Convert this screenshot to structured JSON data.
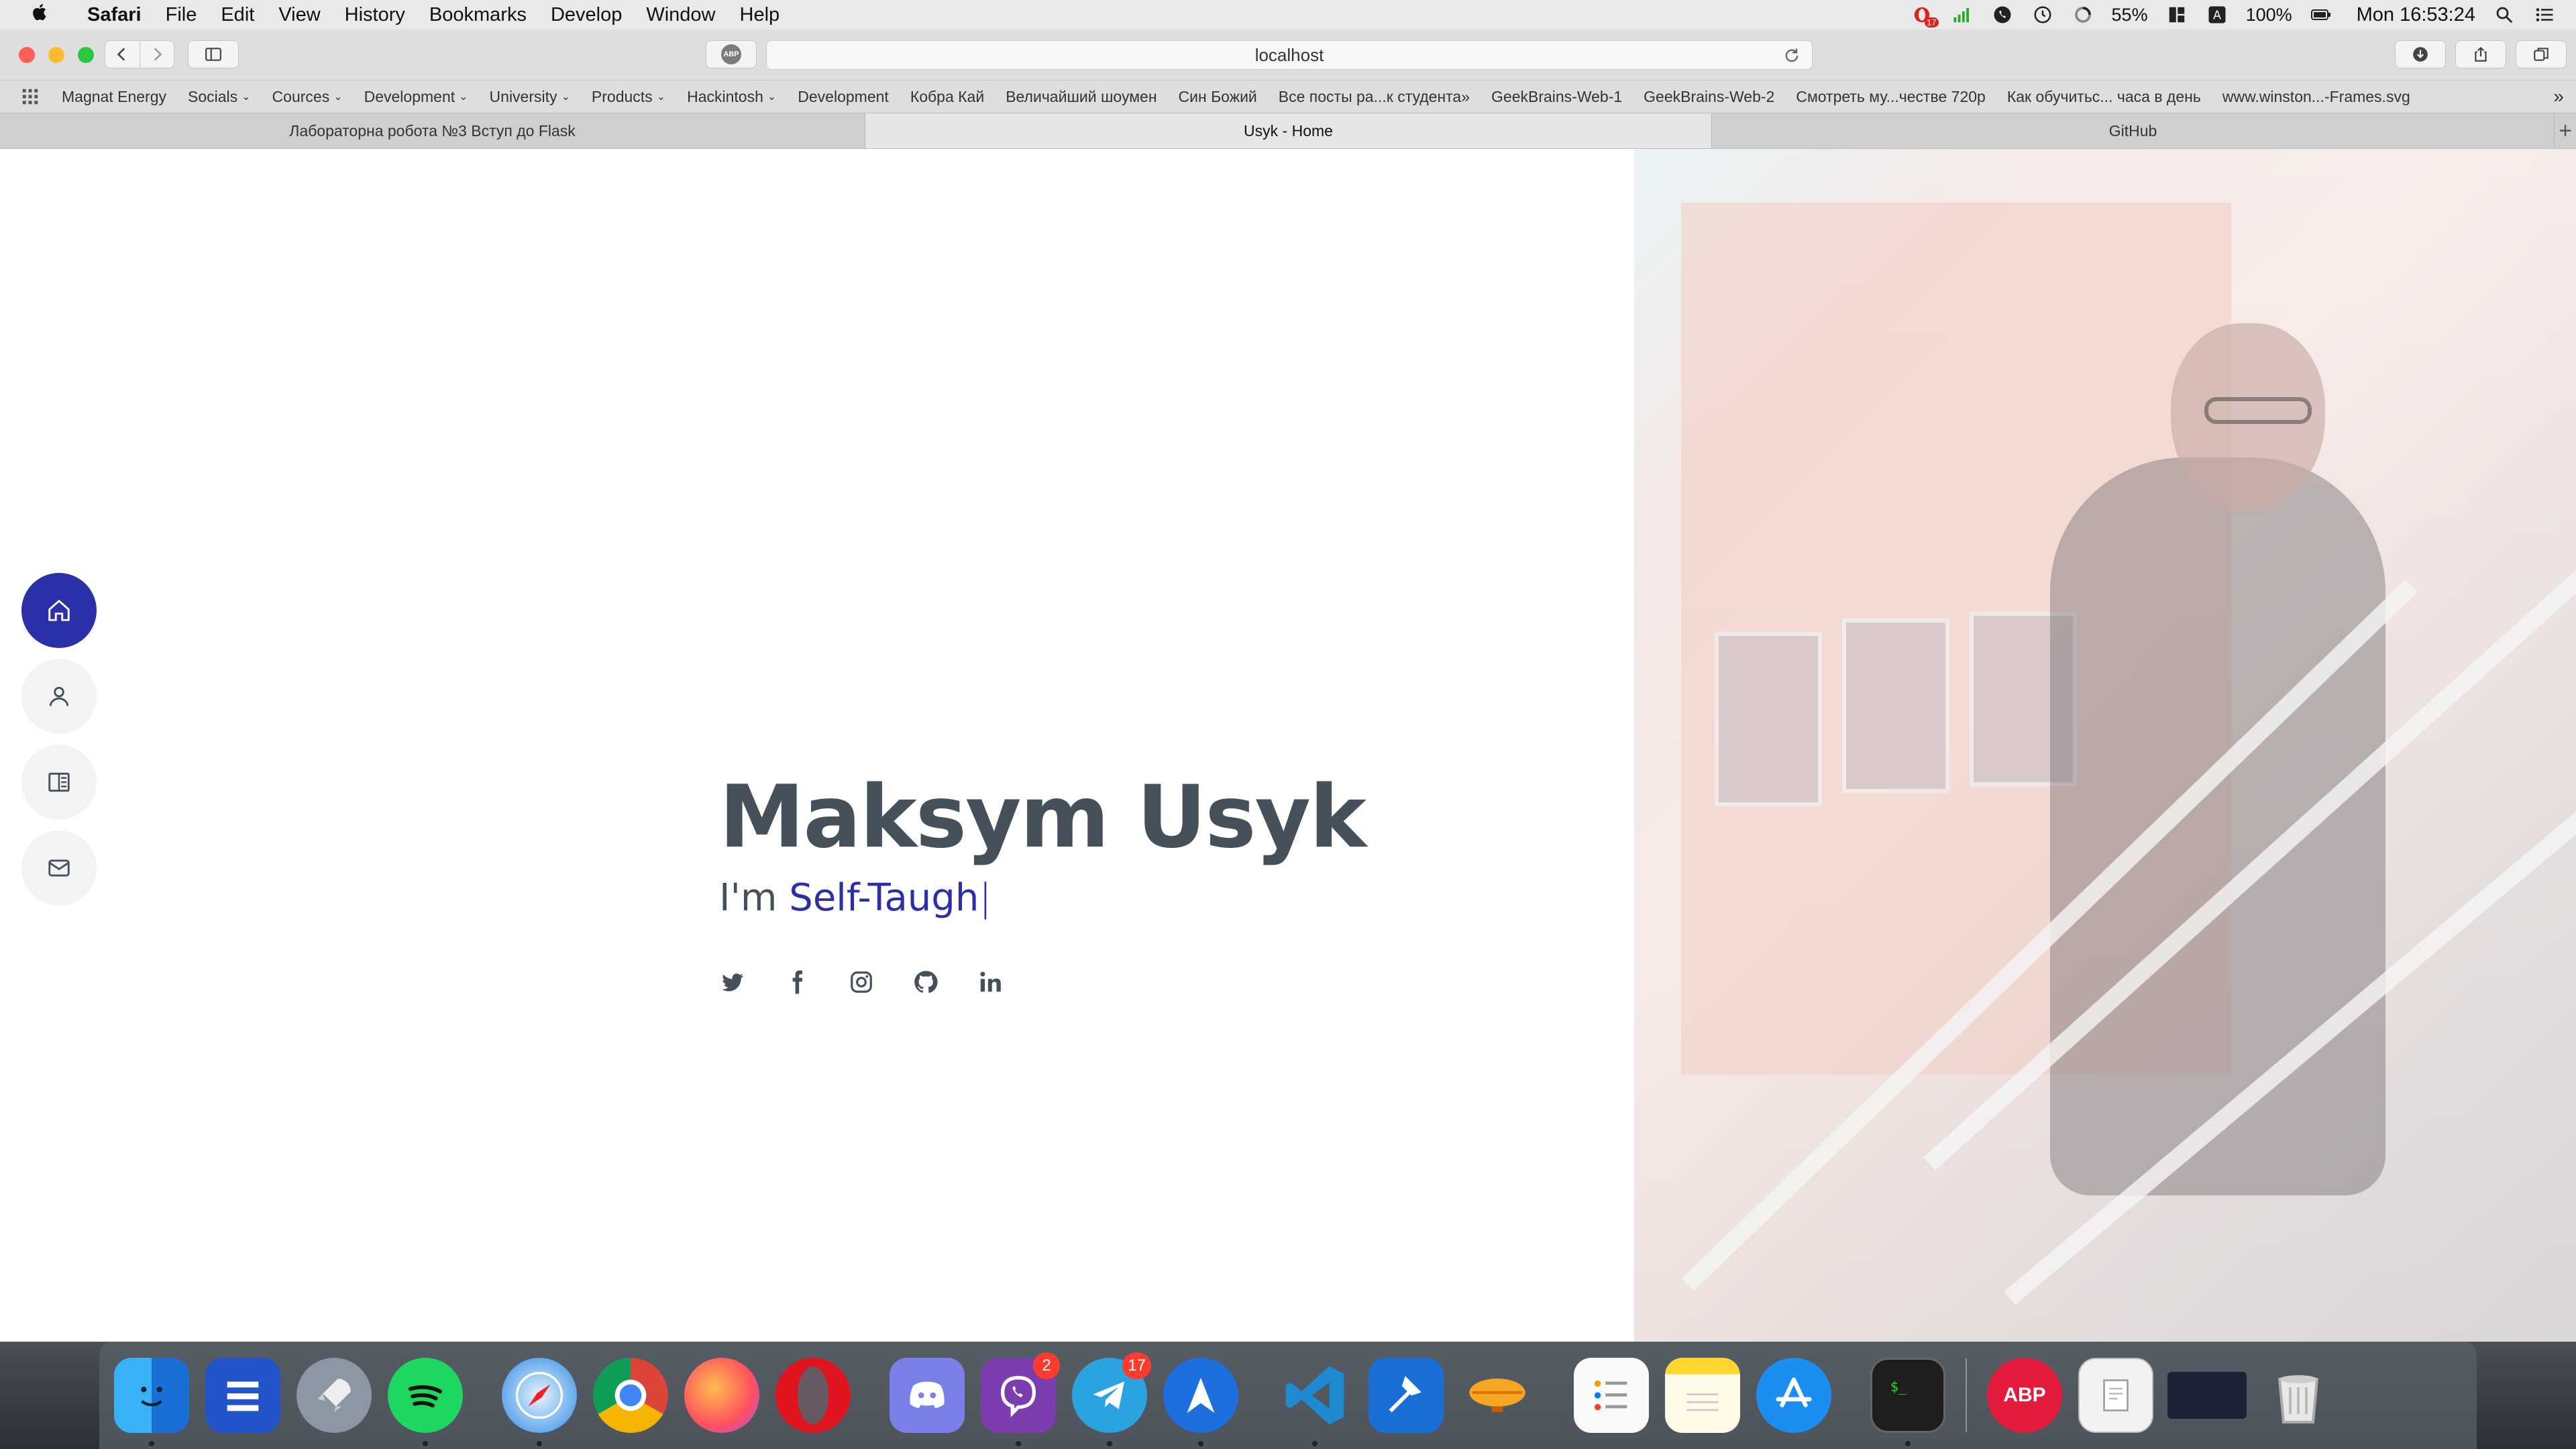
{
  "menubar": {
    "app_name": "Safari",
    "menus": [
      "File",
      "Edit",
      "View",
      "History",
      "Bookmarks",
      "Develop",
      "Window",
      "Help"
    ],
    "battery_percent_text": "55%",
    "volume_text": "100%",
    "clock": "Mon 16:53:24",
    "badge_count": "17"
  },
  "toolbar": {
    "address": "localhost",
    "abp_label": "ABP"
  },
  "bookmarks": [
    {
      "label": "Magnat Energy",
      "folder": false
    },
    {
      "label": "Socials",
      "folder": true
    },
    {
      "label": "Cources",
      "folder": true
    },
    {
      "label": "Development",
      "folder": true
    },
    {
      "label": "University",
      "folder": true
    },
    {
      "label": "Products",
      "folder": true
    },
    {
      "label": "Hackintosh",
      "folder": true
    },
    {
      "label": "Development",
      "folder": false
    },
    {
      "label": "Кобра Кай",
      "folder": false
    },
    {
      "label": "Величайший шоумен",
      "folder": false
    },
    {
      "label": "Син Божий",
      "folder": false
    },
    {
      "label": "Все посты ра...к студента»",
      "folder": false
    },
    {
      "label": "GeekBrains-Web-1",
      "folder": false
    },
    {
      "label": "GeekBrains-Web-2",
      "folder": false
    },
    {
      "label": "Смотреть му...честве 720p",
      "folder": false
    },
    {
      "label": "Как обучитьс... часа в день",
      "folder": false
    },
    {
      "label": "www.winston...-Frames.svg",
      "folder": false
    }
  ],
  "tabs": [
    {
      "label": "Лабораторна робота №3 Вступ до Flask",
      "active": false
    },
    {
      "label": "Usyk - Home",
      "active": true
    },
    {
      "label": "GitHub",
      "active": false
    }
  ],
  "page": {
    "name": "Maksym Usyk",
    "subtitle_prefix": "I'm ",
    "subtitle_typed": "Self-Taugh",
    "cursor": "|",
    "accent_color": "#2b2fa8",
    "side_nav": [
      "home-icon",
      "user-icon",
      "book-icon",
      "mail-icon"
    ],
    "social": [
      "twitter-icon",
      "facebook-icon",
      "instagram-icon",
      "github-icon",
      "linkedin-icon"
    ]
  },
  "dock": {
    "viber_badge": "2",
    "telegram_badge": "17",
    "adblock_label": "ABP"
  }
}
